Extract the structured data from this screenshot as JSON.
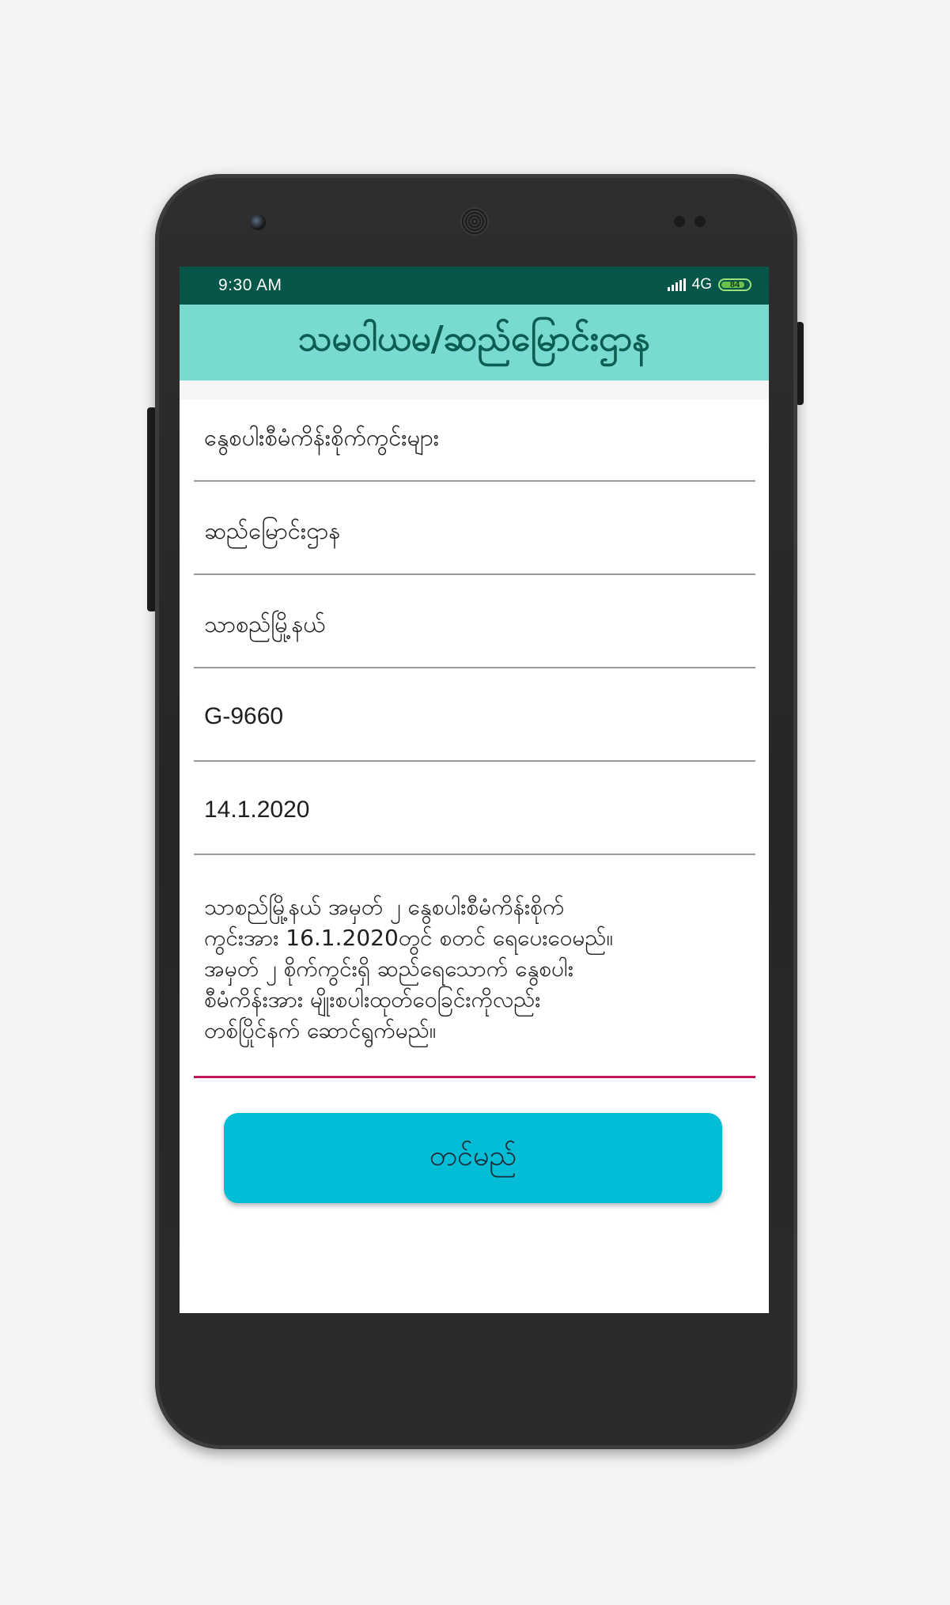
{
  "status_bar": {
    "time": "9:30 AM",
    "network": "4G",
    "battery": "84",
    "battery_level": 0.84
  },
  "app_bar": {
    "title": "သမဝါယမ/ဆည်မြောင်းဌာန"
  },
  "form": {
    "fields": [
      {
        "value": "နွေစပါးစီမံကိန်းစိုက်ကွင်းများ"
      },
      {
        "value": "ဆည်မြောင်းဌာန"
      },
      {
        "value": "သာစည်မြို့နယ်"
      },
      {
        "value": "G-9660"
      },
      {
        "value": "14.1.2020"
      }
    ],
    "description": "သာစည်မြို့နယ် အမှတ် ၂ နွေစပါးစီမံကိန်းစိုက်\nကွင်းအား 16.1.2020တွင် စတင် ရေပေးဝေမည်။\nအမှတ် ၂ စိုက်ကွင်းရှိ ဆည်ရေသောက် နွေစပါး\nစီမံကိန်းအား မျိုးစပါးထုတ်ဝေခြင်းကိုလည်း\nတစ်ပြိုင်နက် ဆောင်ရွက်မည်။"
  },
  "submit_button": {
    "label": "တင်မည်"
  },
  "colors": {
    "status_bar": "#06574a",
    "app_bar": "#79dbcf",
    "title_text": "#0c5d52",
    "button": "#03bcd5",
    "active_underline": "#c2185b"
  }
}
